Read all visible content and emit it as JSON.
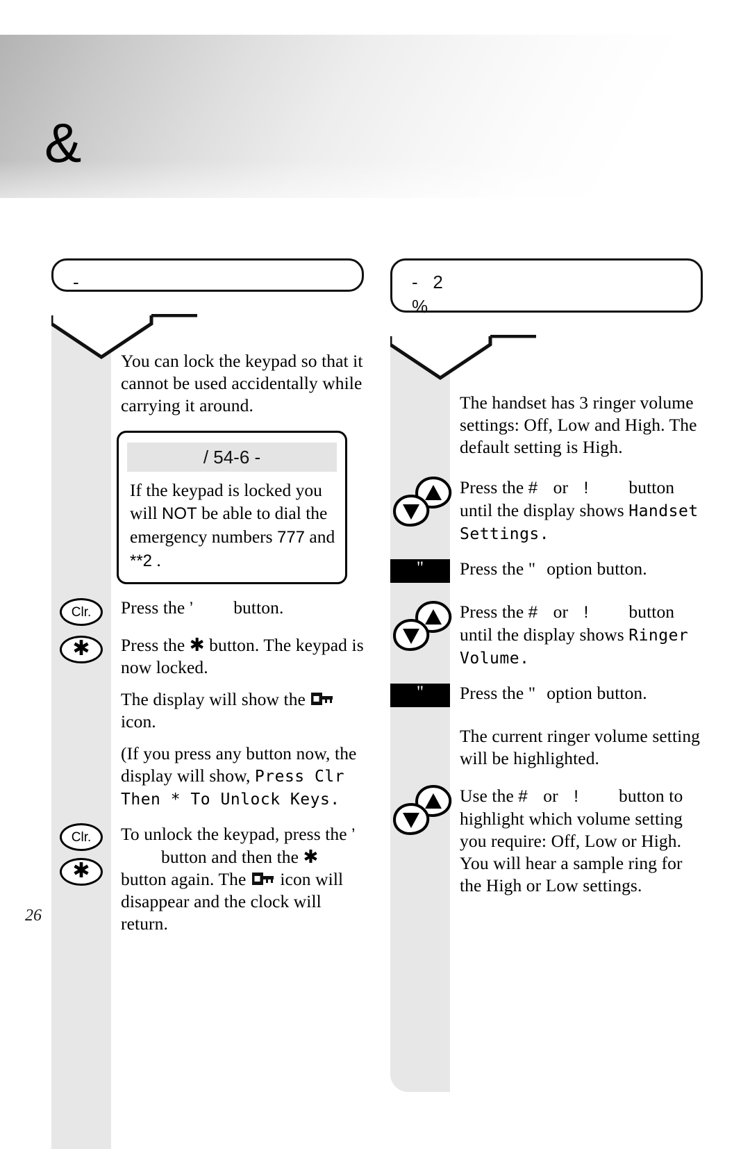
{
  "page": {
    "number": "26",
    "chapter_glyph": "&"
  },
  "left_column": {
    "header": {
      "title": "-"
    },
    "intro": "You can lock the keypad so that it cannot be used accidentally while carrying it around.",
    "warning": {
      "heading": "/ 54-6 -",
      "line1_a": "If the keypad is locked you will ",
      "line1_b": "NOT",
      "line1_c": " be able to dial the emergency numbers ",
      "line1_d": "777",
      "line1_e": " and ",
      "line1_f": "**2",
      "line1_g": " ."
    },
    "steps": [
      {
        "icon": "clr-button-icon",
        "icon_label": "Clr.",
        "text_a": "Press the ",
        "glyph": "’",
        "text_b": "button."
      },
      {
        "icon": "star-button-icon",
        "icon_label": "✱",
        "text_a": "Press the ",
        "glyph": "✱",
        "text_b": " button. The keypad is now locked."
      },
      {
        "icon": "none",
        "text_a": "The display will show the ",
        "glyph": "lock-icon",
        "text_b": " icon."
      },
      {
        "icon": "none",
        "text_a": "(If you press any button now, the display will show, ",
        "lcd": "Press Clr Then * To Unlock Keys."
      },
      {
        "icon": "clr-star-pair-icon",
        "icon_label_1": "Clr.",
        "icon_label_2": "✱",
        "text_a": "To unlock the keypad, press the ",
        "glyph1": "’",
        "text_b": "button and then the ",
        "glyph2": "✱",
        "text_c": " button again. The ",
        "glyph3": "lock-icon",
        "text_d": " icon will disappear and the clock will return."
      }
    ]
  },
  "right_column": {
    "header": {
      "line1": "-   2",
      "line2": "%"
    },
    "intro": "The handset has 3 ringer volume settings: Off, Low and High. The default setting is High.",
    "steps": [
      {
        "icon": "up-down-arrows-icon",
        "text_a": "Press the ",
        "glyph_up": "#",
        "text_or": " or ",
        "glyph_down": "!",
        "text_b": "button until the display shows ",
        "lcd": "Handset Settings",
        "text_c": "."
      },
      {
        "icon": "option-button-icon",
        "icon_label": "\"",
        "text_a": "Press the ",
        "glyph": "\"",
        "text_b": "option button."
      },
      {
        "icon": "up-down-arrows-icon",
        "text_a": "Press the ",
        "glyph_up": "#",
        "text_or": " or ",
        "glyph_down": "!",
        "text_b": "button until the display shows ",
        "lcd": "Ringer Volume",
        "text_c": "."
      },
      {
        "icon": "option-button-icon",
        "icon_label": "\"",
        "text_a": "Press the ",
        "glyph": "\"",
        "text_b": "option button."
      },
      {
        "icon": "none",
        "text_a": "The current ringer volume setting will be highlighted."
      },
      {
        "icon": "up-down-arrows-icon",
        "text_a": "Use the ",
        "glyph_up": "#",
        "text_or": " or ",
        "glyph_down": "!",
        "text_b": "button to highlight which volume setting you require: Off, Low or High. You will hear a sample ring for the High or Low settings."
      }
    ]
  },
  "colors": {
    "rail_grey": "#e7e7e7",
    "warn_head_grey": "#e4e4e4",
    "ink": "#000000"
  }
}
